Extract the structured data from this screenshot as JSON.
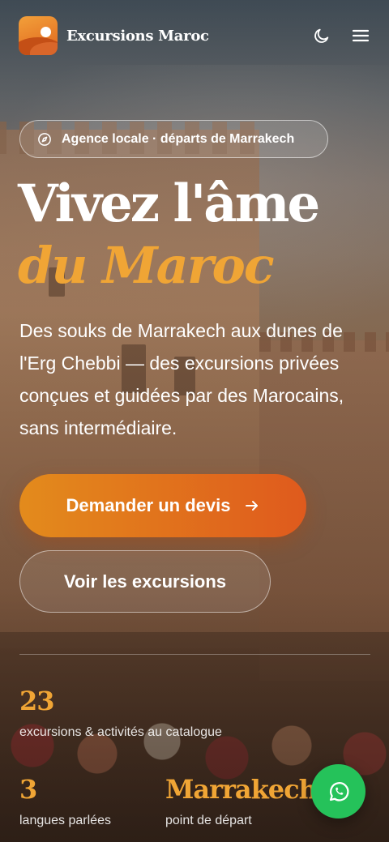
{
  "header": {
    "brand": "Excursions Maroc",
    "logo_icon": "desert-sun-logo",
    "theme_toggle_icon": "moon-icon",
    "menu_icon": "hamburger-menu-icon"
  },
  "hero": {
    "badge_icon": "compass-icon",
    "badge_text": "Agence locale · départs de Marrakech",
    "title_line1": "Vivez l'âme",
    "title_line2": "du Maroc",
    "lead": "Des souks de Marrakech aux dunes de l'Erg Chebbi — des excursions privées conçues et guidées par des Marocains, sans intermédiaire.",
    "primary_cta": "Demander un devis",
    "primary_cta_icon": "arrow-right-icon",
    "secondary_cta": "Voir les excursions"
  },
  "stats": [
    {
      "value": "23",
      "label": "excursions & activités au catalogue"
    },
    {
      "value": "3",
      "label": "langues parlées"
    },
    {
      "value": "Marrakech",
      "label": "point de départ"
    }
  ],
  "floating": {
    "whatsapp_icon": "whatsapp-icon"
  },
  "colors": {
    "accent": "#f0a535",
    "cta_start": "#e38b1c",
    "cta_end": "#df5a1d",
    "whatsapp": "#25c25a"
  }
}
